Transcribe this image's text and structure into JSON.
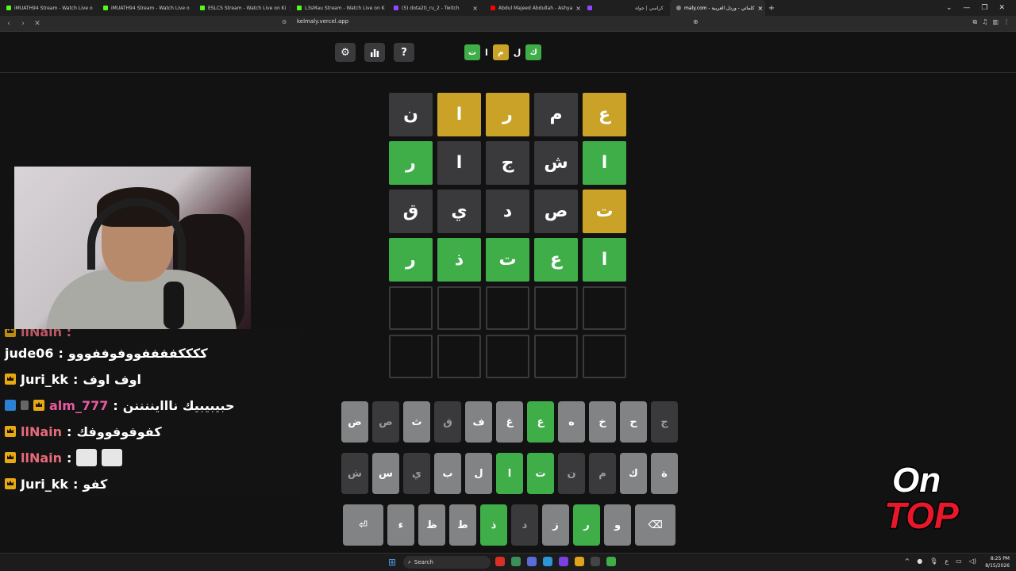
{
  "browser": {
    "tabs": [
      {
        "label": "iMUATH94 Stream - Watch Live o",
        "color": "#53fc18"
      },
      {
        "label": "iMUATH94 Stream - Watch Live o",
        "color": "#53fc18"
      },
      {
        "label": "ESLCS Stream - Watch Live on Ki",
        "color": "#53fc18"
      },
      {
        "label": "L3sMau Stream - Watch Live on K",
        "color": "#53fc18"
      },
      {
        "label": "(5) dota2ti_ru_2 - Twitch",
        "color": "#9146ff"
      },
      {
        "label": "Abdul Majeed Abdullah - Ashya",
        "color": "#ff0000"
      }
    ],
    "extra_tab_label": "كراسي | جولة",
    "active_tab_label": "maly.com - كلماتي - وردل العربية",
    "url": "kelmaly.vercel.app"
  },
  "game": {
    "logo": [
      {
        "ch": "ت",
        "kind": "green"
      },
      {
        "ch": "ا",
        "kind": "plain"
      },
      {
        "ch": "م",
        "kind": "yellow"
      },
      {
        "ch": "ل",
        "kind": "plain"
      },
      {
        "ch": "ك",
        "kind": "green"
      }
    ],
    "board": [
      [
        {
          "ch": "ع",
          "s": "yellow"
        },
        {
          "ch": "م",
          "s": "gray"
        },
        {
          "ch": "ر",
          "s": "yellow"
        },
        {
          "ch": "ا",
          "s": "yellow"
        },
        {
          "ch": "ن",
          "s": "gray"
        }
      ],
      [
        {
          "ch": "ا",
          "s": "green"
        },
        {
          "ch": "ش",
          "s": "gray"
        },
        {
          "ch": "ج",
          "s": "gray"
        },
        {
          "ch": "ا",
          "s": "gray"
        },
        {
          "ch": "ر",
          "s": "green"
        }
      ],
      [
        {
          "ch": "ت",
          "s": "yellow"
        },
        {
          "ch": "ص",
          "s": "gray"
        },
        {
          "ch": "د",
          "s": "gray"
        },
        {
          "ch": "ي",
          "s": "gray"
        },
        {
          "ch": "ق",
          "s": "gray"
        }
      ],
      [
        {
          "ch": "ا",
          "s": "green"
        },
        {
          "ch": "ع",
          "s": "green"
        },
        {
          "ch": "ت",
          "s": "green"
        },
        {
          "ch": "ذ",
          "s": "green"
        },
        {
          "ch": "ر",
          "s": "green"
        }
      ],
      [
        {
          "ch": "",
          "s": "empty"
        },
        {
          "ch": "",
          "s": "empty"
        },
        {
          "ch": "",
          "s": "empty"
        },
        {
          "ch": "",
          "s": "empty"
        },
        {
          "ch": "",
          "s": "empty"
        }
      ],
      [
        {
          "ch": "",
          "s": "empty"
        },
        {
          "ch": "",
          "s": "empty"
        },
        {
          "ch": "",
          "s": "empty"
        },
        {
          "ch": "",
          "s": "empty"
        },
        {
          "ch": "",
          "s": "empty"
        }
      ]
    ],
    "keyboard": [
      [
        {
          "k": "ج",
          "s": "dark"
        },
        {
          "k": "ح",
          "s": "normal"
        },
        {
          "k": "خ",
          "s": "normal"
        },
        {
          "k": "ه",
          "s": "normal"
        },
        {
          "k": "ع",
          "s": "green"
        },
        {
          "k": "غ",
          "s": "normal"
        },
        {
          "k": "ف",
          "s": "normal"
        },
        {
          "k": "ق",
          "s": "dark"
        },
        {
          "k": "ث",
          "s": "normal"
        },
        {
          "k": "ص",
          "s": "dark"
        },
        {
          "k": "ض",
          "s": "normal"
        }
      ],
      [
        {
          "k": "ة",
          "s": "normal"
        },
        {
          "k": "ك",
          "s": "normal"
        },
        {
          "k": "م",
          "s": "dark"
        },
        {
          "k": "ن",
          "s": "dark"
        },
        {
          "k": "ت",
          "s": "green"
        },
        {
          "k": "ا",
          "s": "green"
        },
        {
          "k": "ل",
          "s": "normal"
        },
        {
          "k": "ب",
          "s": "normal"
        },
        {
          "k": "ي",
          "s": "dark"
        },
        {
          "k": "س",
          "s": "normal"
        },
        {
          "k": "ش",
          "s": "dark"
        }
      ],
      [
        {
          "k": "⌫",
          "s": "normal",
          "wide": true
        },
        {
          "k": "و",
          "s": "normal"
        },
        {
          "k": "ر",
          "s": "green"
        },
        {
          "k": "ز",
          "s": "normal"
        },
        {
          "k": "د",
          "s": "dark"
        },
        {
          "k": "ذ",
          "s": "green"
        },
        {
          "k": "ط",
          "s": "normal"
        },
        {
          "k": "ظ",
          "s": "normal"
        },
        {
          "k": "ء",
          "s": "normal"
        },
        {
          "k": "⏎",
          "s": "normal",
          "wide": true
        }
      ]
    ]
  },
  "chat": {
    "partial_top": "llNain :",
    "messages": [
      {
        "user": "jude06",
        "color": "#ffffff",
        "text": "ككككففففووفوففووو",
        "badges": []
      },
      {
        "user": "Juri_kk",
        "color": "#ffffff",
        "text": "اوف اوف",
        "badges": [
          "crown"
        ]
      },
      {
        "user": "alm_777",
        "color": "#e85aa0",
        "text": "حبيبيبيك نااايننننن",
        "badges": [
          "blue",
          "gray",
          "crown"
        ]
      },
      {
        "user": "llNain",
        "color": "#e86a7a",
        "text": "كفوفوفووفك",
        "badges": [
          "crown"
        ]
      },
      {
        "user": "llNain",
        "color": "#e86a7a",
        "text": "",
        "badges": [
          "crown"
        ],
        "emotes": 2
      },
      {
        "user": "Juri_kk",
        "color": "#ffffff",
        "text": "كفو",
        "badges": [
          "crown"
        ]
      }
    ]
  },
  "overlay": {
    "brand_line1": "On",
    "brand_line2": "TOP"
  },
  "taskbar": {
    "search_label": "Search",
    "time": "8:25 PM",
    "date": "8/15/2026"
  }
}
